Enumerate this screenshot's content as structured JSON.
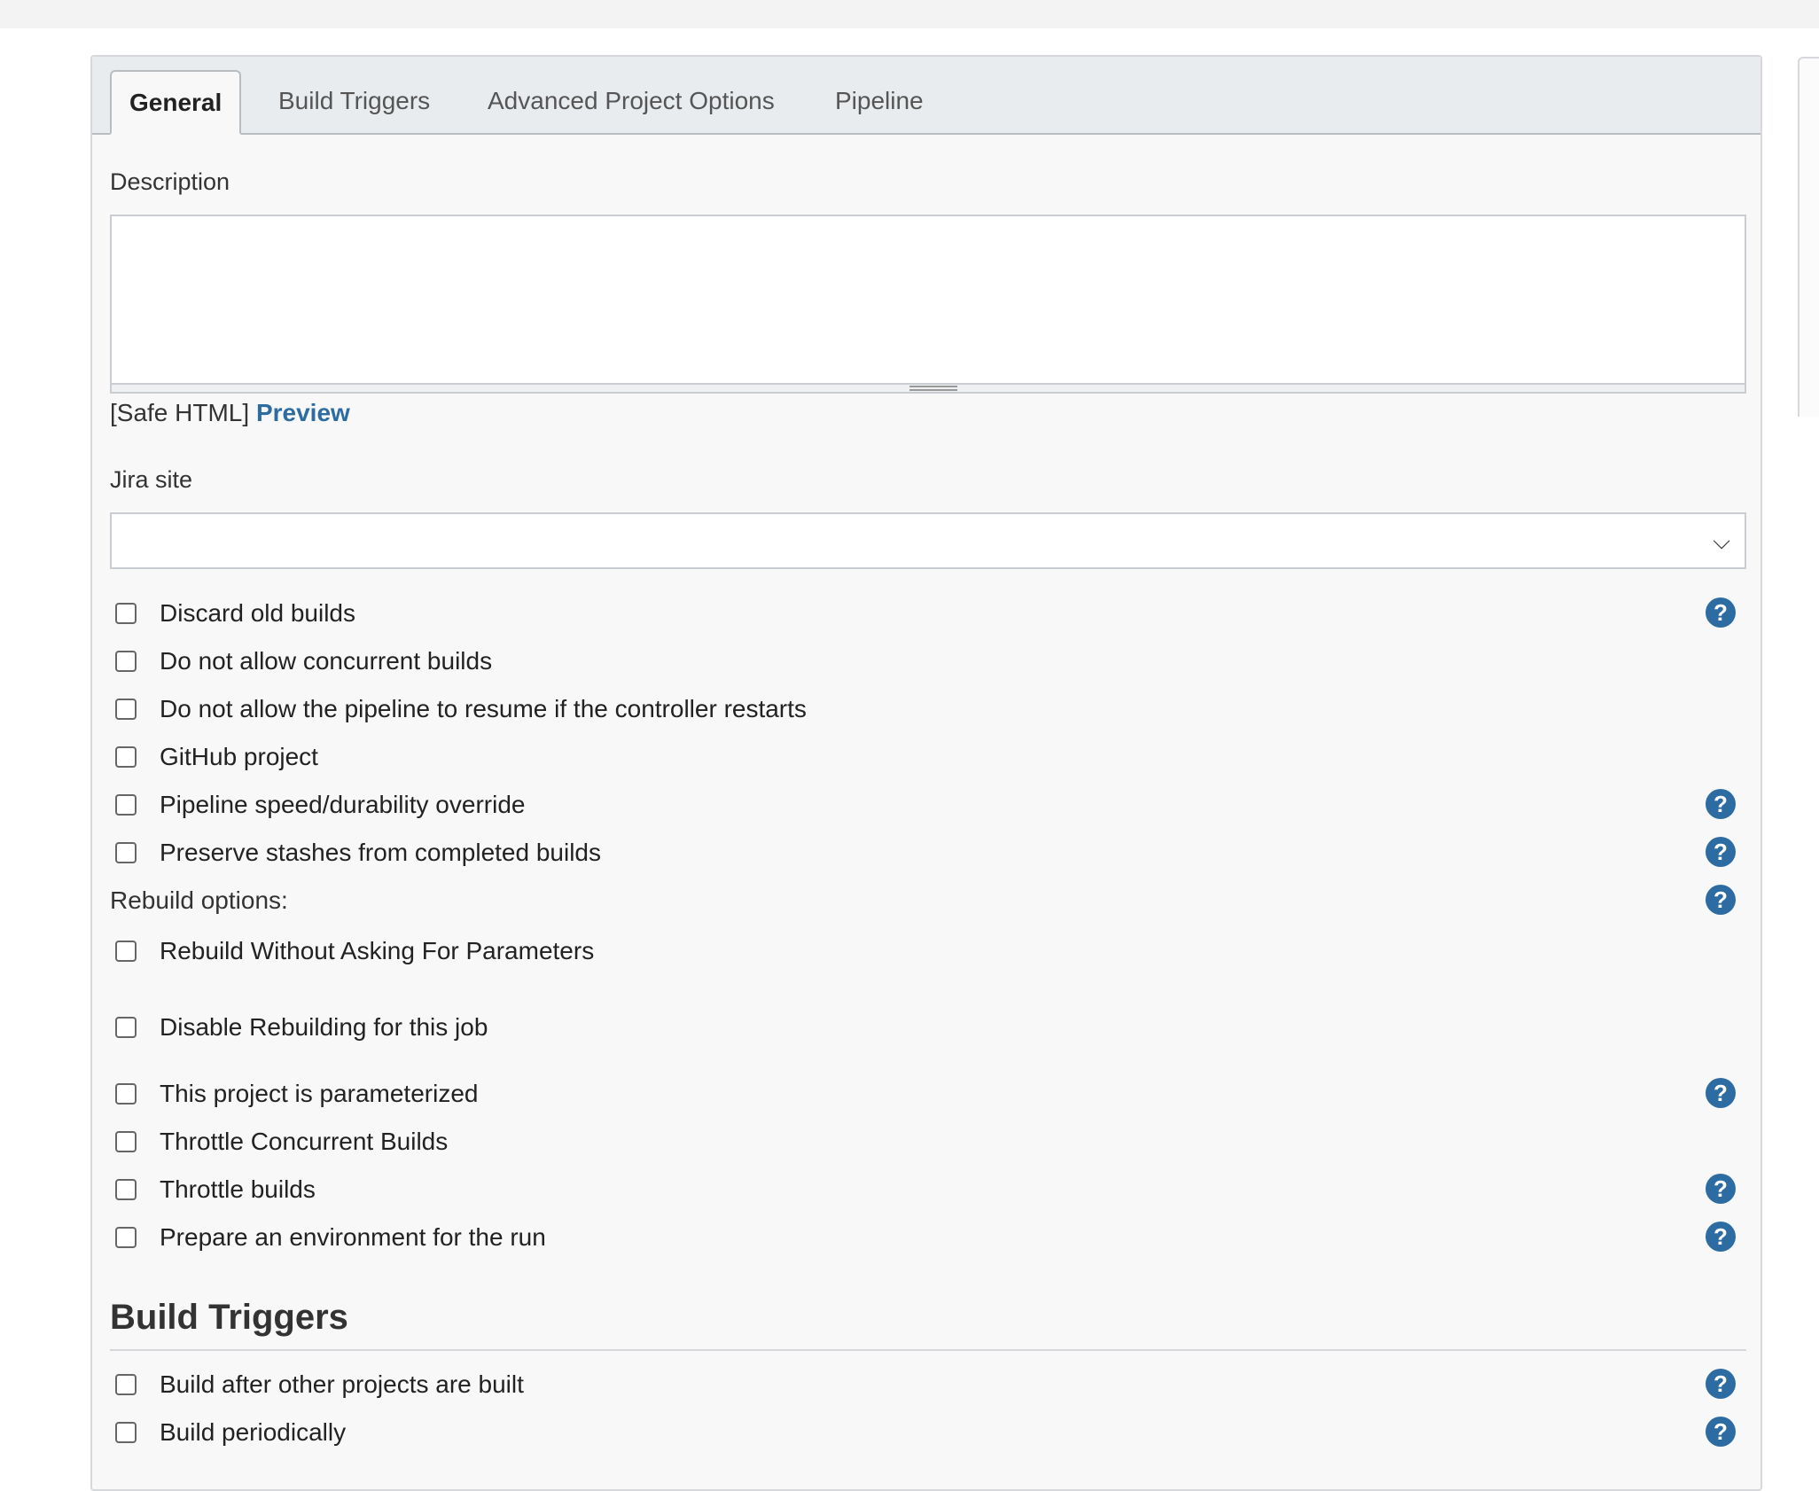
{
  "tabs": [
    {
      "label": "General"
    },
    {
      "label": "Build Triggers"
    },
    {
      "label": "Advanced Project Options"
    },
    {
      "label": "Pipeline"
    }
  ],
  "general": {
    "description_label": "Description",
    "description_value": "",
    "safe_html": "[Safe HTML]",
    "preview_label": "Preview",
    "jira_label": "Jira site",
    "jira_value": "",
    "options": [
      {
        "label": "Discard old builds",
        "checked": false
      },
      {
        "label": "Do not allow concurrent builds",
        "checked": false
      },
      {
        "label": "Do not allow the pipeline to resume if the controller restarts",
        "checked": false
      },
      {
        "label": "GitHub project",
        "checked": false
      },
      {
        "label": "Pipeline speed/durability override",
        "checked": false
      },
      {
        "label": "Preserve stashes from completed builds",
        "checked": false
      }
    ],
    "rebuild_heading": "Rebuild options:",
    "rebuild_options": [
      {
        "label": "Rebuild Without Asking For Parameters",
        "checked": false
      },
      {
        "label": "Disable Rebuilding for this job",
        "checked": false
      }
    ],
    "more_options": [
      {
        "label": "This project is parameterized",
        "checked": false
      },
      {
        "label": "Throttle Concurrent Builds",
        "checked": false
      },
      {
        "label": "Throttle builds",
        "checked": false
      },
      {
        "label": "Prepare an environment for the run",
        "checked": false
      }
    ]
  },
  "build_triggers": {
    "title": "Build Triggers",
    "options": [
      {
        "label": "Build after other projects are built",
        "checked": false
      },
      {
        "label": "Build periodically",
        "checked": false
      }
    ]
  },
  "icons": {
    "help": "?",
    "dropdown": "⌵"
  },
  "colors": {
    "link": "#2d6ca2",
    "help_icon": "#2d6ca2",
    "panel_bg": "#f8f8f8",
    "tabbar_bg": "#e9ecef"
  }
}
